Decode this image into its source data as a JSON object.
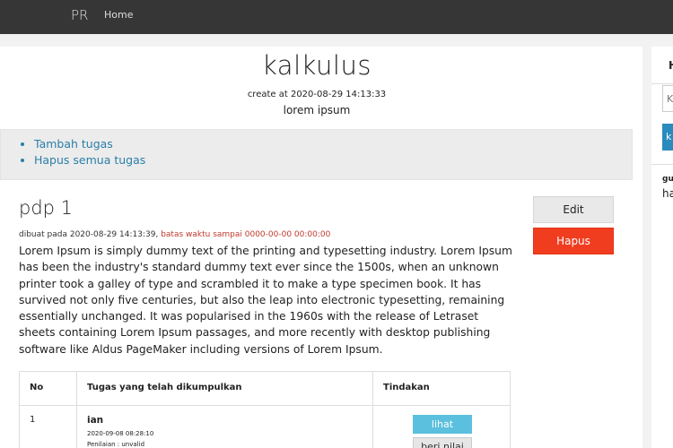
{
  "navbar": {
    "brand": "PR",
    "home": "Home"
  },
  "header": {
    "title": "kalkulus",
    "created": "create at 2020-08-29 14:13:33",
    "subtitle": "lorem ipsum"
  },
  "actions": {
    "tambah": "Tambah tugas",
    "hapus_semua": "Hapus semua tugas"
  },
  "task": {
    "title": "pdp 1",
    "meta_created": "dibuat pada 2020-08-29 14:13:39,",
    "meta_deadline": "batas waktu sampai 0000-00-00 00:00:00",
    "description": "Lorem Ipsum is simply dummy text of the printing and typesetting industry. Lorem Ipsum has been the industry's standard dummy text ever since the 1500s, when an unknown printer took a galley of type and scrambled it to make a type specimen book. It has survived not only five centuries, but also the leap into electronic typesetting, remaining essentially unchanged. It was popularised in the 1960s with the release of Letraset sheets containing Lorem Ipsum passages, and more recently with desktop publishing software like Aldus PageMaker including versions of Lorem Ipsum.",
    "edit_label": "Edit",
    "hapus_label": "Hapus"
  },
  "table": {
    "headers": [
      "No",
      "Tugas yang telah dikumpulkan",
      "Tindakan"
    ],
    "rows": [
      {
        "no": "1",
        "name": "ian",
        "date": "2020-09-08 08:28:10",
        "status": "Penilaian : unvalid",
        "lihat": "lihat",
        "nilai": "beri nilai"
      }
    ]
  },
  "sidebar": {
    "heading": "H",
    "input_placeholder": "K",
    "button": "k",
    "label": "gu",
    "text": "ha"
  },
  "colors": {
    "navbar": "#363636",
    "link": "#2a7ea8",
    "danger": "#f03c1f",
    "info": "#5bc0de"
  }
}
